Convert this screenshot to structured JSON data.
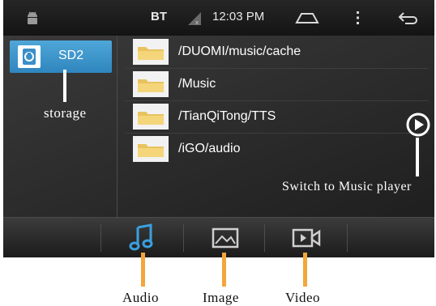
{
  "status_bar": {
    "bt_label": "BT",
    "time": "12:03 PM",
    "icons": [
      "android-debug-icon",
      "signal-icon",
      "home-icon",
      "overflow-menu-icon",
      "back-icon"
    ]
  },
  "storage": {
    "items": [
      {
        "label": "SD2",
        "icon": "sd-card-icon",
        "selected": true
      }
    ]
  },
  "folders": [
    {
      "path": "/DUOMI/music/cache",
      "icon": "folder-icon"
    },
    {
      "path": "/Music",
      "icon": "folder-icon"
    },
    {
      "path": "/TianQiTong/TTS",
      "icon": "folder-icon"
    },
    {
      "path": "/iGO/audio",
      "icon": "folder-icon"
    }
  ],
  "tabs": [
    {
      "key": "audio",
      "icon": "music-note-icon",
      "active": true
    },
    {
      "key": "image",
      "icon": "image-icon",
      "active": false
    },
    {
      "key": "video",
      "icon": "video-icon",
      "active": false
    }
  ],
  "annotations": {
    "storage": "storage",
    "switch_player": "Switch to Music player",
    "audio": "Audio",
    "image": "Image",
    "video": "Video"
  },
  "colors": {
    "accent_blue": "#3a95cc",
    "callout_orange": "#f3a63c",
    "background": "#2c2c2c"
  }
}
